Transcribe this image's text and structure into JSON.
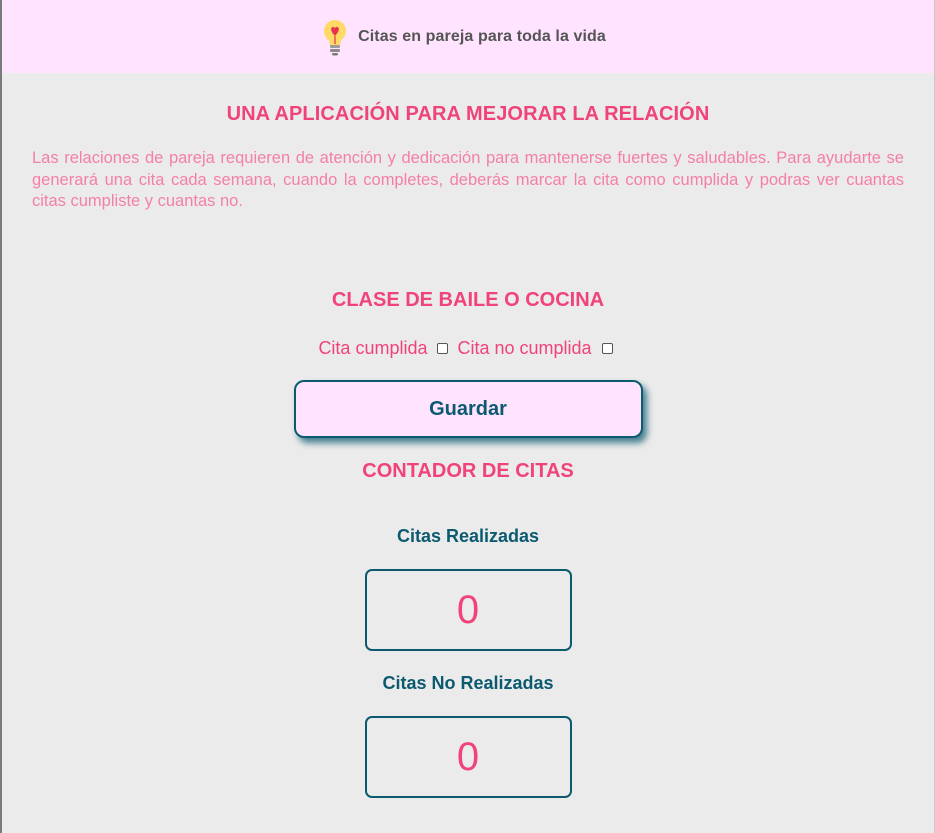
{
  "header": {
    "icon": "lightbulb-heart-icon",
    "title": "Citas en pareja para toda la vida"
  },
  "intro": {
    "heading": "UNA APLICACIÓN PARA MEJORAR LA RELACIÓN",
    "text": "Las relaciones de pareja requieren de atención y dedicación para mantenerse fuertes y saludables. Para ayudarte se generará una cita cada semana, cuando la completes, deberás marcar la cita como cumplida y podras ver cuantas citas cumpliste y cuantas no."
  },
  "activity": {
    "title": "CLASE DE BAILE O COCINA",
    "done_label": "Cita cumplida",
    "done_checked": false,
    "not_done_label": "Cita no cumplida",
    "not_done_checked": false,
    "save_label": "Guardar"
  },
  "counter": {
    "title": "CONTADOR DE CITAS",
    "done_label": "Citas Realizadas",
    "done_value": "0",
    "not_done_label": "Citas No Realizadas",
    "not_done_value": "0"
  },
  "colors": {
    "header_bg": "#ffe3ff",
    "page_bg": "#ebebeb",
    "accent_pink": "#f0437a",
    "text_pink": "#f57fa6",
    "teal": "#0c5a70",
    "header_text": "#555555"
  }
}
